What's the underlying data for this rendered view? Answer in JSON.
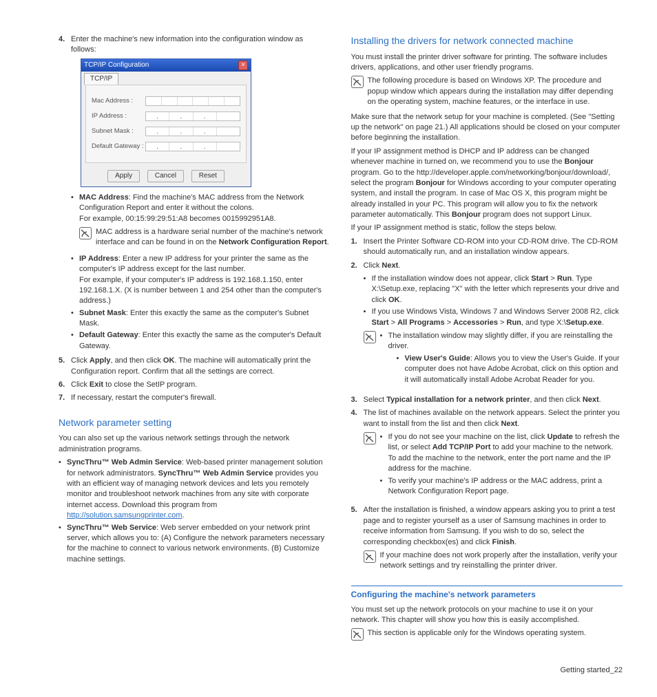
{
  "left": {
    "step4_intro": "Enter the machine's new information into the configuration window as follows:",
    "dialog": {
      "title": "TCP/IP Configuration",
      "tab": "TCP/IP",
      "rows": [
        "Mac Address :",
        "IP Address :",
        "Subnet Mask :",
        "Default Gateway :"
      ],
      "buttons": [
        "Apply",
        "Cancel",
        "Reset"
      ]
    },
    "mac_label": "MAC Address",
    "mac_desc": ": Find the machine's MAC address from the Network Configuration Report and enter it without the colons.",
    "mac_example": "For example, 00:15:99:29:51:A8 becomes 0015992951A8.",
    "mac_note": "MAC address is a hardware serial number of the machine's network interface and can be found in on the ",
    "mac_note_bold": "Network Configuration Report",
    "ip_label": "IP Address",
    "ip_desc": ": Enter a new IP address for your printer the same as the computer's IP address except for the last number.",
    "ip_example": "For example, if your computer's IP address is 192.168.1.150, enter 192.168.1.X. (X is number between 1 and 254 other than the computer's address.)",
    "subnet_label": "Subnet Mask",
    "subnet_desc": ": Enter this exactly the same as the computer's Subnet Mask.",
    "gateway_label": "Default Gateway",
    "gateway_desc": ": Enter this exactly the same as the computer's Default Gateway.",
    "step5_a": "Click ",
    "step5_b": "Apply",
    "step5_c": ", and then click ",
    "step5_d": "OK",
    "step5_e": ". The machine will automatically print the Configuration report. Confirm that all the settings are correct.",
    "step6_a": "Click ",
    "step6_b": "Exit",
    "step6_c": " to close the SetIP program.",
    "step7": "If necessary, restart the computer's firewall.",
    "netparam_h": "Network parameter setting",
    "netparam_p": "You can also set up the various network settings through the network administration programs.",
    "swa_label": "SyncThru™ Web Admin Service",
    "swa_desc": ": Web-based printer management solution for network administrators. ",
    "swa_desc2": " provides you with an efficient way of managing network devices and lets you remotely monitor and troubleshoot network machines from any site with corporate internet access. Download this program from ",
    "swa_link": "http://solution.samsungprinter.com",
    "sws_label": "SyncThru™ Web Service",
    "sws_desc": ": Web server embedded on your network print server, which allows you to: (A) Configure the network parameters necessary for the machine to connect to various network environments. (B) Customize machine settings."
  },
  "right": {
    "install_h": "Installing the drivers for network connected machine",
    "install_p1": "You must install the printer driver software for printing. The software includes drivers, applications, and other user friendly programs.",
    "install_note": "The following procedure is based on Windows XP. The procedure and popup window which appears during the installation may differ depending on the operating system, machine features, or the interface in use.",
    "install_p2": "Make sure that the network setup for your machine is completed. (See \"Setting up the network\" on page 21.) All applications should be closed on your computer before beginning the installation.",
    "install_p3a": "If your IP assignment method is DHCP and IP address can be changed whenever machine in turned on, we recommend you to use the ",
    "install_p3b": "Bonjour",
    "install_p3c": " program. Go to the http://developer.apple.com/networking/bonjour/download/, select the program ",
    "install_p3d": " for Windows according to your computer operating system, and install the program. In case of Mac OS X, this program might be already installed in your PC. This program will allow you to fix the network parameter automatically. This ",
    "install_p3e": " program does not support Linux.",
    "install_p4": "If your IP assignment method is static, follow the steps below.",
    "s1": "Insert the Printer Software CD-ROM into your CD-ROM drive. The CD-ROM should automatically run, and an installation window appears.",
    "s2a": "Click ",
    "s2b": "Next",
    "s2_b1a": "If the installation window does not appear, click ",
    "s2_b1b": "Start",
    "s2_b1c": " > ",
    "s2_b1d": "Run",
    "s2_b1e": ". Type X:\\Setup.exe, replacing \"X\" with the letter which represents your drive and click ",
    "s2_b1f": "OK",
    "s2_b2a": "If you use Windows Vista, Windows 7 and Windows Server 2008 R2, click ",
    "s2_b2b": "Start",
    "s2_b2c": "All Programs",
    "s2_b2d": "Accessories",
    "s2_b2e": "Run",
    "s2_b2f": ", and type X:\\",
    "s2_b2g": "Setup.exe",
    "s2_note1": "The installation window may slightly differ, if you are reinstalling the driver.",
    "s2_note2a": "View User's Guide",
    "s2_note2b": ": Allows you to view the User's Guide. If your computer does not have Adobe Acrobat, click on this option and it will automatically install Adobe Acrobat Reader for you.",
    "s3a": "Select ",
    "s3b": "Typical installation for a network printer",
    "s3c": ", and then click ",
    "s3d": "Next",
    "s4a": "The list of machines available on the network appears. Select the printer you want to install from the list and then click ",
    "s4b": "Next",
    "s4_note_b1a": "If you do not see your machine on the list, click ",
    "s4_note_b1b": "Update",
    "s4_note_b1c": " to refresh the list, or select ",
    "s4_note_b1d": "Add TCP/IP Port",
    "s4_note_b1e": " to add your machine to the network. To add the machine to the network, enter the port name and the IP address for the machine.",
    "s4_note_b2": "To verify your machine's IP address or the MAC address, print a Network Configuration Report page.",
    "s5a": "After the installation is finished, a window appears asking you to print a test page and to register yourself as a user of Samsung machines in order to receive information from Samsung. If you wish to do so, select the corresponding checkbox(es) and click ",
    "s5b": "Finish",
    "s5_note": "If your machine does not work properly after the installation, verify your network settings and try reinstalling the printer driver.",
    "config_h": "Configuring the machine's network parameters",
    "config_p": "You must set up the network protocols on your machine to use it on your network. This chapter will show you how this is easily accomplished.",
    "config_note": "This section is applicable only for the Windows operating system."
  },
  "footer": {
    "label": "Getting started",
    "page": "_22"
  }
}
